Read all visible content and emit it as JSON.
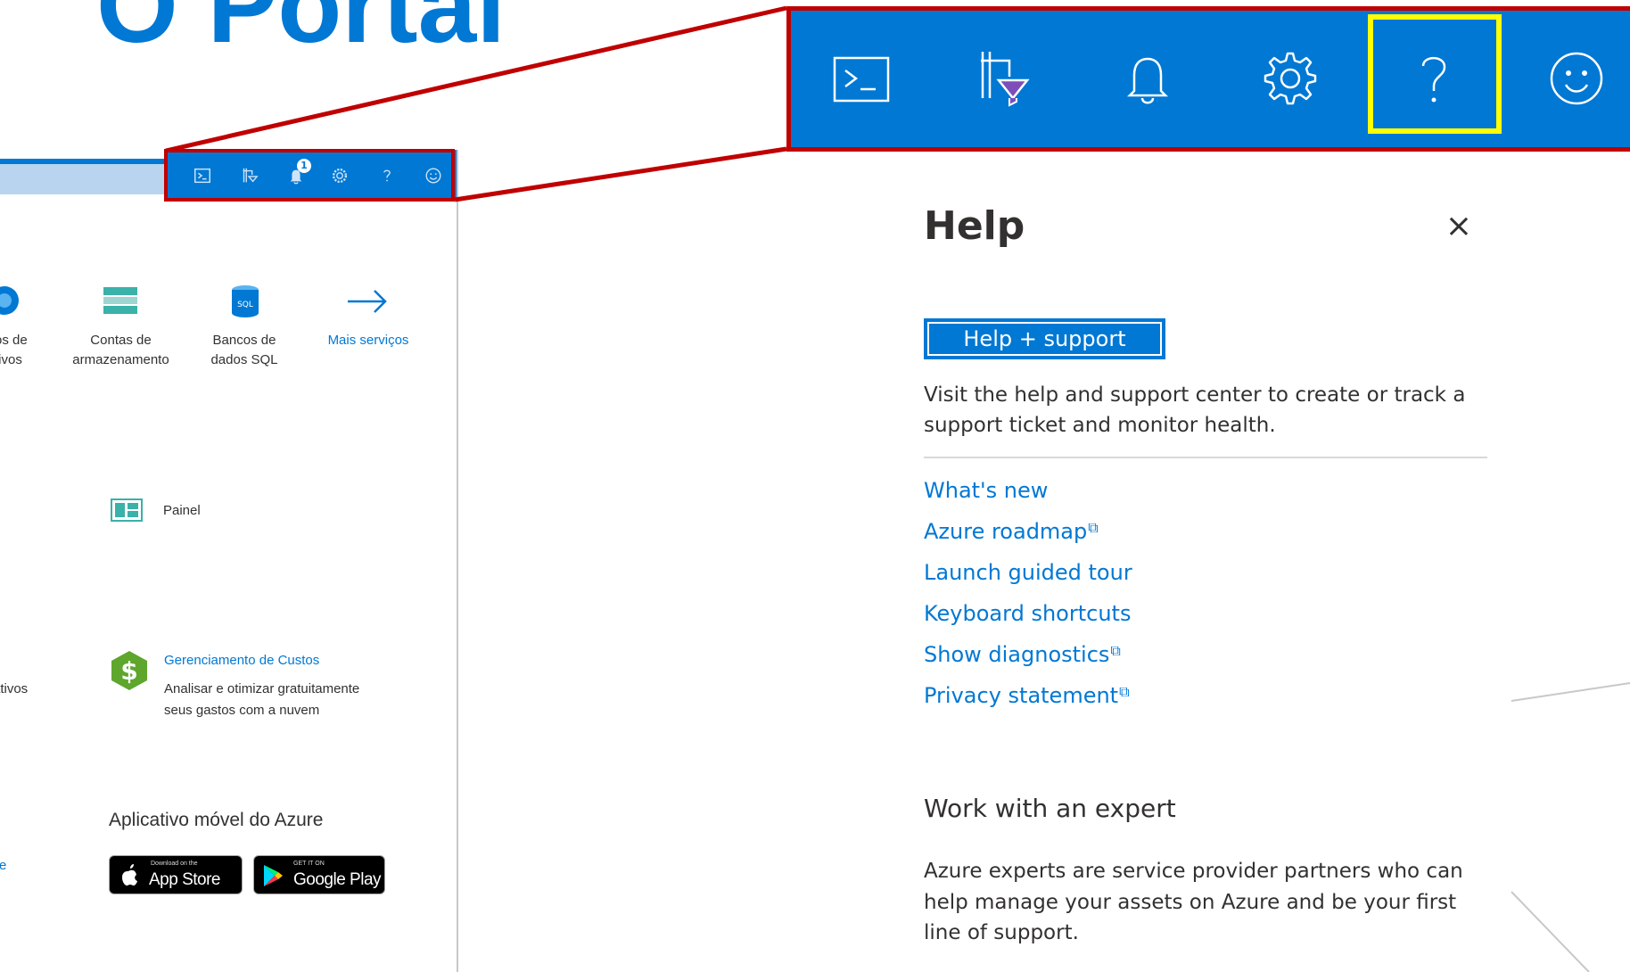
{
  "slide": {
    "title": "O Portal"
  },
  "portal": {
    "services": [
      {
        "label": "Contas de armazenamento",
        "lines": [
          "Contas de",
          "armazenamento"
        ]
      },
      {
        "label": "Bancos de dados SQL",
        "lines": [
          "Bancos de",
          "dados SQL"
        ]
      },
      {
        "label": "Mais serviços",
        "lines": [
          "Mais serviços"
        ]
      }
    ],
    "left_fragments": [
      "os de",
      "tivos",
      "ativos",
      "re"
    ],
    "dashboard_label": "Painel",
    "cost_management": {
      "title": "Gerenciamento de Custos",
      "desc_lines": [
        "Analisar e otimizar gratuitamente",
        "seus gastos com a nuvem"
      ]
    },
    "mobile_app": {
      "heading": "Aplicativo móvel do Azure",
      "app_store": {
        "small": "Download on the",
        "big": "App Store"
      },
      "google_play": {
        "small": "GET IT ON",
        "big": "Google Play"
      }
    },
    "notification_count": "1",
    "sql_badge": "SQL",
    "header_icons": [
      "cloud-shell-icon",
      "directory-filter-icon",
      "notifications-icon",
      "settings-icon",
      "help-icon",
      "feedback-icon"
    ]
  },
  "header": {
    "icons": [
      "cloud-shell-icon",
      "directory-filter-icon",
      "notifications-icon",
      "settings-icon",
      "help-icon",
      "feedback-icon"
    ],
    "highlighted": "help-icon"
  },
  "help_pane": {
    "title": "Help",
    "close_glyph": "×",
    "support_button": "Help + support",
    "description": "Visit the help and support center to create or track a support ticket and monitor health.",
    "links": [
      {
        "label": "What's new",
        "external": false
      },
      {
        "label": "Azure roadmap",
        "external": true
      },
      {
        "label": "Launch guided tour",
        "external": false
      },
      {
        "label": "Keyboard shortcuts",
        "external": false
      },
      {
        "label": "Show diagnostics",
        "external": true
      },
      {
        "label": "Privacy statement",
        "external": true
      }
    ],
    "external_glyph": "⧉",
    "expert_heading": "Work with an expert",
    "expert_description": "Azure experts are service provider partners who can help manage your assets on Azure and be your first line of support."
  },
  "colors": {
    "azure_blue": "#0078d4",
    "callout_red": "#c00000",
    "highlight_yellow": "#ffff00",
    "cost_green": "#5ea62c"
  }
}
